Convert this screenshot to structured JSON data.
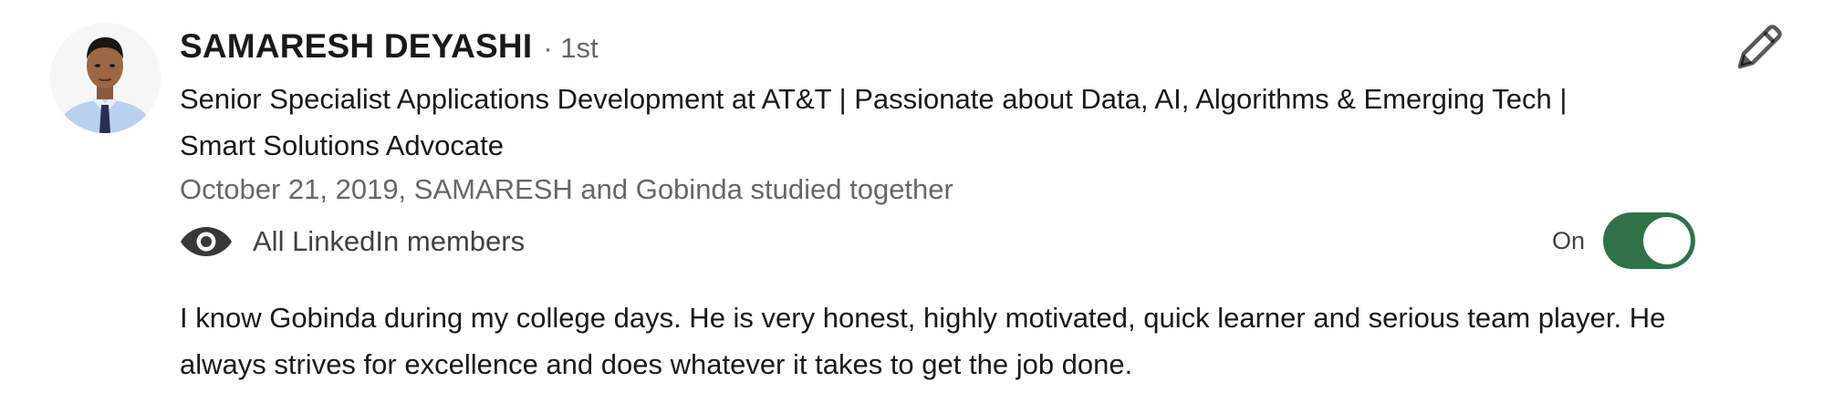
{
  "recommendation": {
    "author_name": "SAMARESH DEYASHI",
    "connection_degree": "· 1st",
    "headline": "Senior Specialist Applications Development at AT&T | Passionate about Data, AI, Algorithms & Emerging Tech | Smart Solutions Advocate",
    "meta": "October 21, 2019, SAMARESH and Gobinda studied together",
    "visibility": {
      "icon": "eye-icon",
      "label": "All LinkedIn members"
    },
    "toggle": {
      "state_label": "On",
      "on": true,
      "color": "#2f7249"
    },
    "text": "I know Gobinda during my college days. He is very honest, highly motivated, quick learner and serious team player. He always strives for excellence and does whatever it takes to get the job done.",
    "edit_icon": "pencil-icon"
  }
}
